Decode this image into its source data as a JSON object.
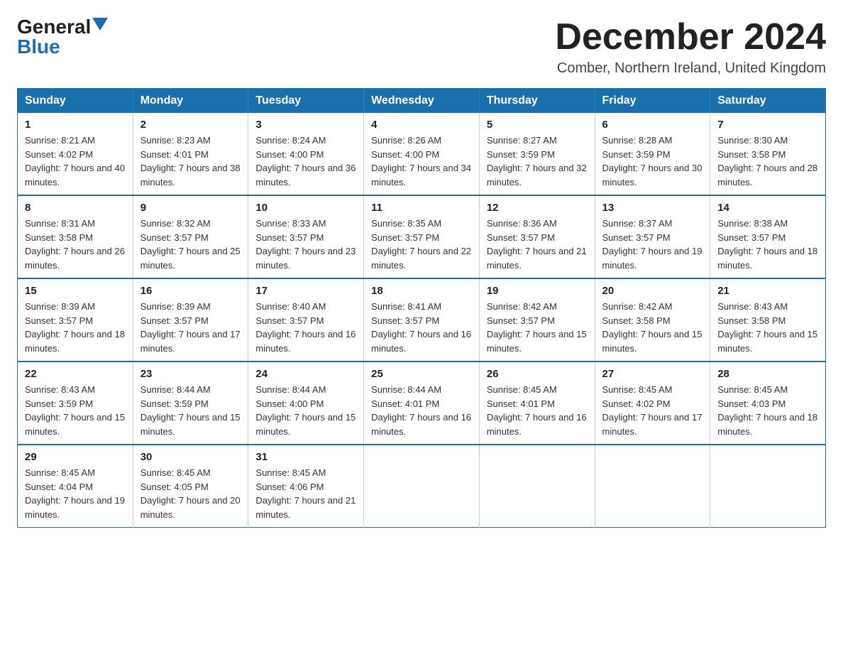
{
  "logo": {
    "general": "General",
    "blue": "Blue"
  },
  "title": "December 2024",
  "location": "Comber, Northern Ireland, United Kingdom",
  "weekdays": [
    "Sunday",
    "Monday",
    "Tuesday",
    "Wednesday",
    "Thursday",
    "Friday",
    "Saturday"
  ],
  "weeks": [
    [
      {
        "day": "1",
        "sunrise": "8:21 AM",
        "sunset": "4:02 PM",
        "daylight": "7 hours and 40 minutes."
      },
      {
        "day": "2",
        "sunrise": "8:23 AM",
        "sunset": "4:01 PM",
        "daylight": "7 hours and 38 minutes."
      },
      {
        "day": "3",
        "sunrise": "8:24 AM",
        "sunset": "4:00 PM",
        "daylight": "7 hours and 36 minutes."
      },
      {
        "day": "4",
        "sunrise": "8:26 AM",
        "sunset": "4:00 PM",
        "daylight": "7 hours and 34 minutes."
      },
      {
        "day": "5",
        "sunrise": "8:27 AM",
        "sunset": "3:59 PM",
        "daylight": "7 hours and 32 minutes."
      },
      {
        "day": "6",
        "sunrise": "8:28 AM",
        "sunset": "3:59 PM",
        "daylight": "7 hours and 30 minutes."
      },
      {
        "day": "7",
        "sunrise": "8:30 AM",
        "sunset": "3:58 PM",
        "daylight": "7 hours and 28 minutes."
      }
    ],
    [
      {
        "day": "8",
        "sunrise": "8:31 AM",
        "sunset": "3:58 PM",
        "daylight": "7 hours and 26 minutes."
      },
      {
        "day": "9",
        "sunrise": "8:32 AM",
        "sunset": "3:57 PM",
        "daylight": "7 hours and 25 minutes."
      },
      {
        "day": "10",
        "sunrise": "8:33 AM",
        "sunset": "3:57 PM",
        "daylight": "7 hours and 23 minutes."
      },
      {
        "day": "11",
        "sunrise": "8:35 AM",
        "sunset": "3:57 PM",
        "daylight": "7 hours and 22 minutes."
      },
      {
        "day": "12",
        "sunrise": "8:36 AM",
        "sunset": "3:57 PM",
        "daylight": "7 hours and 21 minutes."
      },
      {
        "day": "13",
        "sunrise": "8:37 AM",
        "sunset": "3:57 PM",
        "daylight": "7 hours and 19 minutes."
      },
      {
        "day": "14",
        "sunrise": "8:38 AM",
        "sunset": "3:57 PM",
        "daylight": "7 hours and 18 minutes."
      }
    ],
    [
      {
        "day": "15",
        "sunrise": "8:39 AM",
        "sunset": "3:57 PM",
        "daylight": "7 hours and 18 minutes."
      },
      {
        "day": "16",
        "sunrise": "8:39 AM",
        "sunset": "3:57 PM",
        "daylight": "7 hours and 17 minutes."
      },
      {
        "day": "17",
        "sunrise": "8:40 AM",
        "sunset": "3:57 PM",
        "daylight": "7 hours and 16 minutes."
      },
      {
        "day": "18",
        "sunrise": "8:41 AM",
        "sunset": "3:57 PM",
        "daylight": "7 hours and 16 minutes."
      },
      {
        "day": "19",
        "sunrise": "8:42 AM",
        "sunset": "3:57 PM",
        "daylight": "7 hours and 15 minutes."
      },
      {
        "day": "20",
        "sunrise": "8:42 AM",
        "sunset": "3:58 PM",
        "daylight": "7 hours and 15 minutes."
      },
      {
        "day": "21",
        "sunrise": "8:43 AM",
        "sunset": "3:58 PM",
        "daylight": "7 hours and 15 minutes."
      }
    ],
    [
      {
        "day": "22",
        "sunrise": "8:43 AM",
        "sunset": "3:59 PM",
        "daylight": "7 hours and 15 minutes."
      },
      {
        "day": "23",
        "sunrise": "8:44 AM",
        "sunset": "3:59 PM",
        "daylight": "7 hours and 15 minutes."
      },
      {
        "day": "24",
        "sunrise": "8:44 AM",
        "sunset": "4:00 PM",
        "daylight": "7 hours and 15 minutes."
      },
      {
        "day": "25",
        "sunrise": "8:44 AM",
        "sunset": "4:01 PM",
        "daylight": "7 hours and 16 minutes."
      },
      {
        "day": "26",
        "sunrise": "8:45 AM",
        "sunset": "4:01 PM",
        "daylight": "7 hours and 16 minutes."
      },
      {
        "day": "27",
        "sunrise": "8:45 AM",
        "sunset": "4:02 PM",
        "daylight": "7 hours and 17 minutes."
      },
      {
        "day": "28",
        "sunrise": "8:45 AM",
        "sunset": "4:03 PM",
        "daylight": "7 hours and 18 minutes."
      }
    ],
    [
      {
        "day": "29",
        "sunrise": "8:45 AM",
        "sunset": "4:04 PM",
        "daylight": "7 hours and 19 minutes."
      },
      {
        "day": "30",
        "sunrise": "8:45 AM",
        "sunset": "4:05 PM",
        "daylight": "7 hours and 20 minutes."
      },
      {
        "day": "31",
        "sunrise": "8:45 AM",
        "sunset": "4:06 PM",
        "daylight": "7 hours and 21 minutes."
      },
      null,
      null,
      null,
      null
    ]
  ]
}
